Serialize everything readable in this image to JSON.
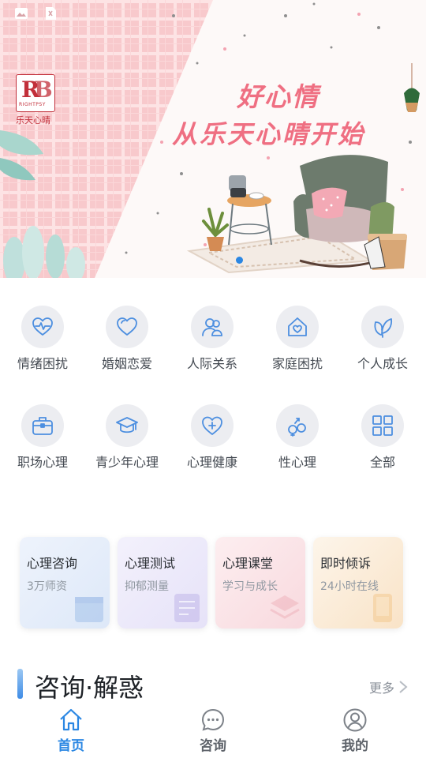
{
  "banner": {
    "brand_name": "乐天心晴",
    "brand_sub": "RIGHTPSY",
    "slogan_line1": "好心情",
    "slogan_line2": "从乐天心晴开始"
  },
  "categories": [
    {
      "label": "情绪困扰",
      "icon": "heartbeat-icon"
    },
    {
      "label": "婚姻恋爱",
      "icon": "heart-icon"
    },
    {
      "label": "人际关系",
      "icon": "people-icon"
    },
    {
      "label": "家庭困扰",
      "icon": "home-heart-icon"
    },
    {
      "label": "个人成长",
      "icon": "leaf-icon"
    },
    {
      "label": "职场心理",
      "icon": "briefcase-icon"
    },
    {
      "label": "青少年心理",
      "icon": "graduation-cap-icon"
    },
    {
      "label": "心理健康",
      "icon": "heart-plus-icon"
    },
    {
      "label": "性心理",
      "icon": "gender-icon"
    },
    {
      "label": "全部",
      "icon": "grid-icon"
    }
  ],
  "cards": [
    {
      "title": "心理咨询",
      "subtitle": "3万师资",
      "icon": "calendar-icon"
    },
    {
      "title": "心理测试",
      "subtitle": "抑郁测量",
      "icon": "document-icon"
    },
    {
      "title": "心理课堂",
      "subtitle": "学习与成长",
      "icon": "layers-icon"
    },
    {
      "title": "即时倾诉",
      "subtitle": "24小时在线",
      "icon": "phone-icon"
    }
  ],
  "section": {
    "title": "咨询·解惑",
    "more": "更多"
  },
  "tabs": [
    {
      "label": "首页",
      "icon": "home-icon",
      "active": true
    },
    {
      "label": "咨询",
      "icon": "chat-icon",
      "active": false
    },
    {
      "label": "我的",
      "icon": "user-icon",
      "active": false
    }
  ],
  "colors": {
    "accent": "#2b87e3",
    "icon_blue": "#4d8fe0",
    "slogan_pink": "#ef6f82",
    "tab_inactive": "#7c8188",
    "card_blue": "#e8effb",
    "card_purple": "#efedfb",
    "card_pink": "#fbe7ea",
    "card_orange": "#fdf1e2"
  }
}
